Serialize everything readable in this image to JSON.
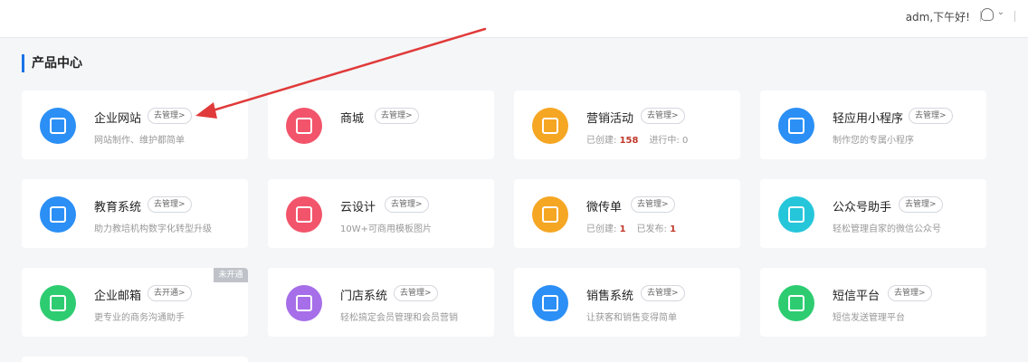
{
  "topbar": {
    "greeting": "adm,下午好!",
    "icons": [
      "headset-icon",
      "chevron-down-icon"
    ]
  },
  "section": {
    "title": "产品中心"
  },
  "cards": [
    {
      "title": "企业网站",
      "manage": "去管理>",
      "desc": "网站制作、维护都简单",
      "icon": "website-icon",
      "color": "#2b8ff5"
    },
    {
      "title": "商城",
      "manage": "去管理>",
      "desc": "",
      "icon": "shopping-bag-icon",
      "color": "#f2546b"
    },
    {
      "title": "营销活动",
      "manage": "去管理>",
      "stats": [
        {
          "label": "已创建:",
          "value": "158"
        },
        {
          "label": "进行中:",
          "value": "0"
        }
      ],
      "icon": "gift-icon",
      "color": "#f5a623"
    },
    {
      "title": "轻应用小程序",
      "manage": "去管理>",
      "desc": "制作您的专属小程序",
      "icon": "mini-program-icon",
      "color": "#2b8ff5"
    },
    {
      "title": "教育系统",
      "manage": "去管理>",
      "desc": "助力教培机构数字化转型升级",
      "icon": "book-icon",
      "color": "#2b8ff5"
    },
    {
      "title": "云设计",
      "manage": "去管理>",
      "desc": "10W+可商用模板图片",
      "icon": "image-icon",
      "color": "#f2546b"
    },
    {
      "title": "微传单",
      "manage": "去管理>",
      "stats": [
        {
          "label": "已创建:",
          "value": "1"
        },
        {
          "label": "已发布:",
          "value": "1"
        }
      ],
      "icon": "flyer-icon",
      "color": "#f5a623"
    },
    {
      "title": "公众号助手",
      "manage": "去管理>",
      "desc": "轻松管理自家的微信公众号",
      "icon": "wechat-icon",
      "color": "#26c6da"
    },
    {
      "title": "企业邮箱",
      "manage": "去开通>",
      "desc": "更专业的商务沟通助手",
      "icon": "mail-icon",
      "color": "#2ecc71",
      "badge": "未开通"
    },
    {
      "title": "门店系统",
      "manage": "去管理>",
      "desc": "轻松搞定会员管理和会员营销",
      "icon": "store-icon",
      "color": "#a66ee8"
    },
    {
      "title": "销售系统",
      "manage": "去管理>",
      "desc": "让获客和销售变得简单",
      "icon": "list-icon",
      "color": "#2b8ff5"
    },
    {
      "title": "短信平台",
      "manage": "去管理>",
      "desc": "短信发送管理平台",
      "icon": "sms-icon",
      "color": "#2ecc71"
    }
  ],
  "annotation": {
    "arrow_color": "#e03a3a"
  }
}
